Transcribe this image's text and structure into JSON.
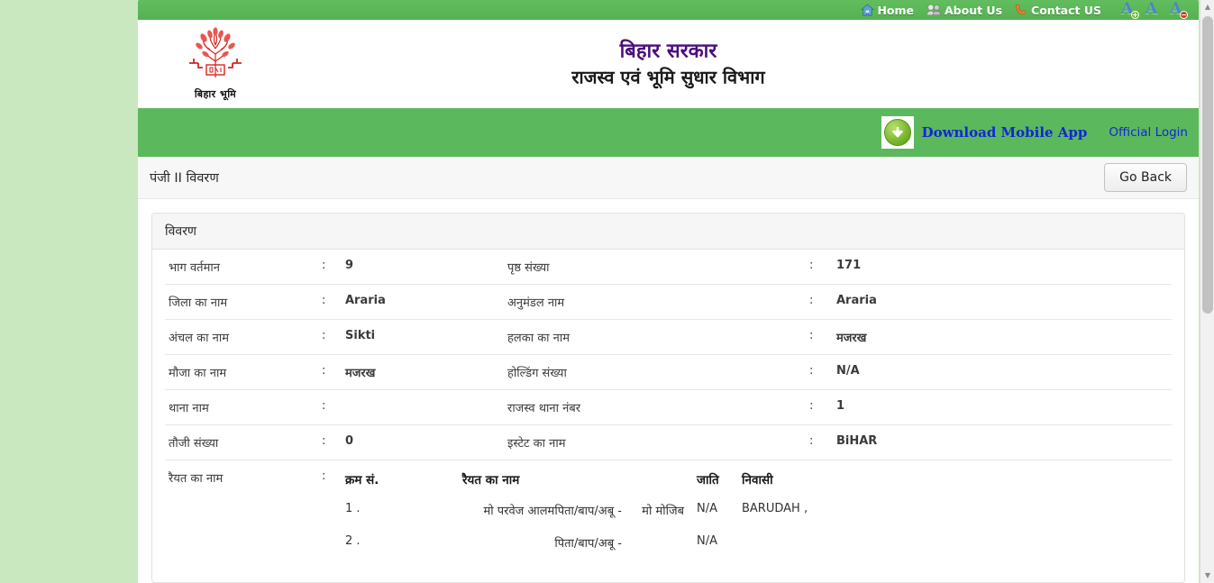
{
  "topnav": {
    "items": [
      {
        "label": "Home",
        "icon": "home-icon"
      },
      {
        "label": "About Us",
        "icon": "people-icon"
      },
      {
        "label": "Contact US",
        "icon": "phone-icon"
      }
    ],
    "font_size_controls": [
      {
        "name": "increase-font-size",
        "letter": "A",
        "badge": "+"
      },
      {
        "name": "default-font-size",
        "letter": "A",
        "badge": ""
      },
      {
        "name": "decrease-font-size",
        "letter": "A",
        "badge": "−"
      }
    ]
  },
  "masthead": {
    "logo_caption": "बिहार भूमि",
    "title_main": "बिहार सरकार",
    "title_sub": "राजस्व एवं भूमि सुधार विभाग"
  },
  "greenbar": {
    "download_label": "Download Mobile App",
    "official_login_label": "Official Login"
  },
  "pagehead": {
    "title": "पंजी II विवरण",
    "go_back_label": "Go Back"
  },
  "panel": {
    "heading": "विवरण",
    "rows": [
      {
        "label": "भाग वर्तमान",
        "value": "9",
        "label2": "पृष्ठ संख्या",
        "value2": "171"
      },
      {
        "label": "जिला का नाम",
        "value": "Araria",
        "label2": "अनुमंडल नाम",
        "value2": "Araria"
      },
      {
        "label": "अंचल का नाम",
        "value": "Sikti",
        "label2": "हलका का नाम",
        "value2": "मजरख"
      },
      {
        "label": "मौजा का नाम",
        "value": "मजरख",
        "label2": "होल्डिंग संख्या",
        "value2": "N/A"
      },
      {
        "label": "थाना नाम",
        "value": "",
        "label2": "राजस्व थाना नंबर",
        "value2": "1"
      },
      {
        "label": "तौजी संख्या",
        "value": "0",
        "label2": "इस्टेट का नाम",
        "value2": "BiHAR"
      }
    ],
    "raiyat_section": {
      "label": "रैयत का नाम",
      "colon": ":",
      "headers": {
        "sno": "क्रम सं.",
        "name": "रैयत का नाम",
        "caste": "जाति",
        "residence": "निवासी"
      },
      "rows": [
        {
          "sno": "1 .",
          "name": "मो परवेज आलम",
          "relation": "पिता/बाप/अबू -",
          "father": "मो मोजिब",
          "caste": "N/A",
          "residence": "BARUDAH ,"
        },
        {
          "sno": "2 .",
          "name": "",
          "relation": "पिता/बाप/अबू -",
          "father": "",
          "caste": "N/A",
          "residence": ""
        }
      ]
    }
  },
  "colors": {
    "green_bar": "#5cb85c",
    "page_background": "#c9e8c0",
    "title_purple": "#4b0f7a",
    "link_blue": "#1226d8"
  }
}
